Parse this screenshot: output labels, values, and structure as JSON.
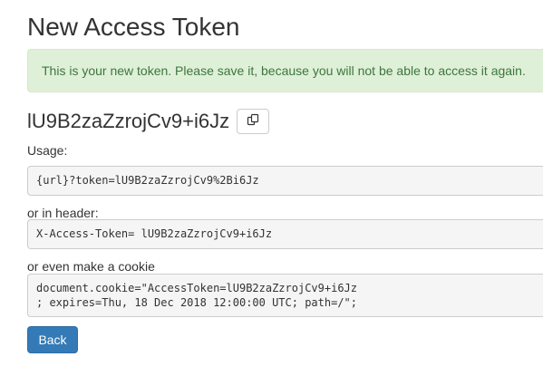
{
  "page": {
    "title": "New Access Token"
  },
  "alert": {
    "message": "This is your new token. Please save it, because you will not be able to access it again."
  },
  "token": {
    "value": "lU9B2zaZzrojCv9+i6Jz",
    "copy_icon": "copy-icon"
  },
  "usage": {
    "label": "Usage:",
    "url_example": "{url}?token=lU9B2zaZzrojCv9%2Bi6Jz"
  },
  "header": {
    "label": "or in header:",
    "example": "X-Access-Token= lU9B2zaZzrojCv9+i6Jz"
  },
  "cookie": {
    "label": "or even make a cookie",
    "line1": "document.cookie=\"AccessToken=lU9B2zaZzrojCv9+i6Jz",
    "line2": "; expires=Thu, 18 Dec 2018 12:00:00 UTC; path=/\";"
  },
  "actions": {
    "back_label": "Back"
  },
  "colors": {
    "alert_bg": "#dff0d8",
    "alert_text": "#3c763d",
    "primary": "#337ab7"
  }
}
